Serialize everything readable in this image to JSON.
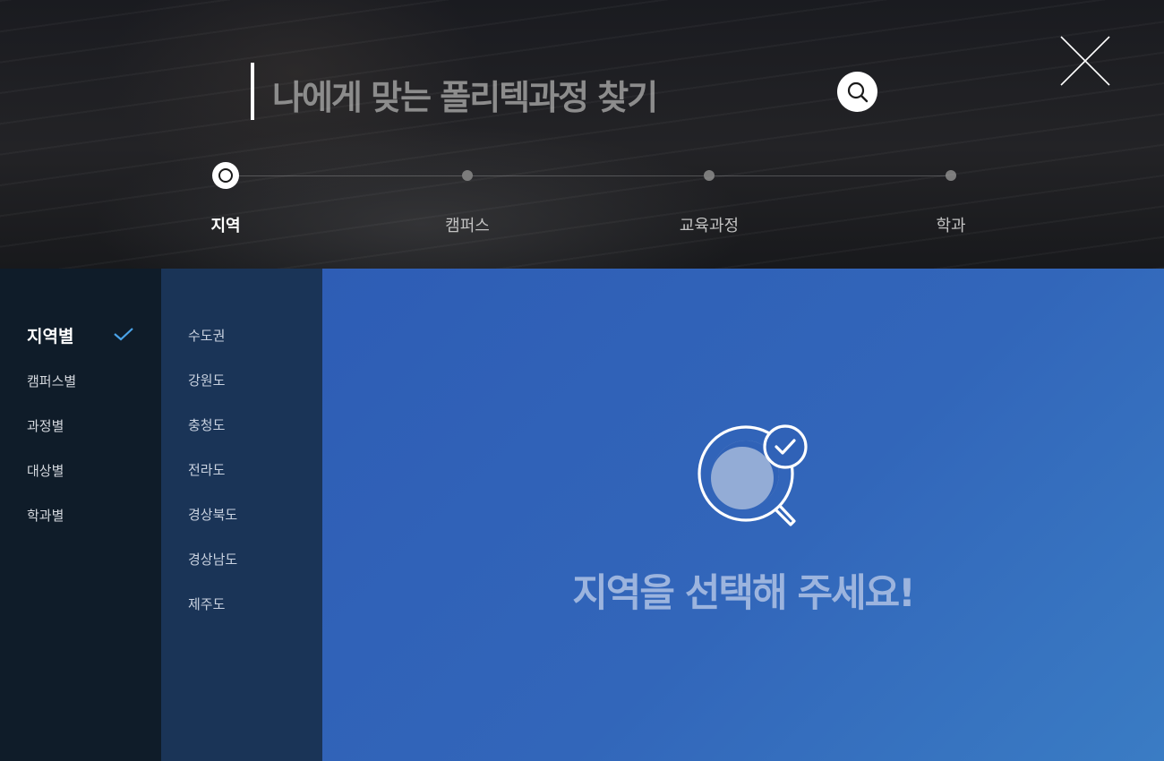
{
  "header": {
    "search_title": "나에게 맞는 폴리텍과정 찾기",
    "search_icon": "search-icon",
    "close_icon": "close-icon"
  },
  "steps": [
    {
      "label": "지역",
      "active": true
    },
    {
      "label": "캠퍼스",
      "active": false
    },
    {
      "label": "교육과정",
      "active": false
    },
    {
      "label": "학과",
      "active": false
    }
  ],
  "categories": [
    {
      "label": "지역별",
      "selected": true
    },
    {
      "label": "캠퍼스별"
    },
    {
      "label": "과정별"
    },
    {
      "label": "대상별"
    },
    {
      "label": "학과별"
    }
  ],
  "regions": [
    "수도권",
    "강원도",
    "충청도",
    "전라도",
    "경상북도",
    "경상남도",
    "제주도"
  ],
  "main": {
    "empty_message": "지역을 선택해 주세요!",
    "empty_icon": "search-check-icon"
  },
  "colors": {
    "accent_check": "#4aa3e8",
    "panel_dark": "#0f1c29",
    "panel_mid": "#1a3457",
    "main_blue": "#3062b7"
  }
}
